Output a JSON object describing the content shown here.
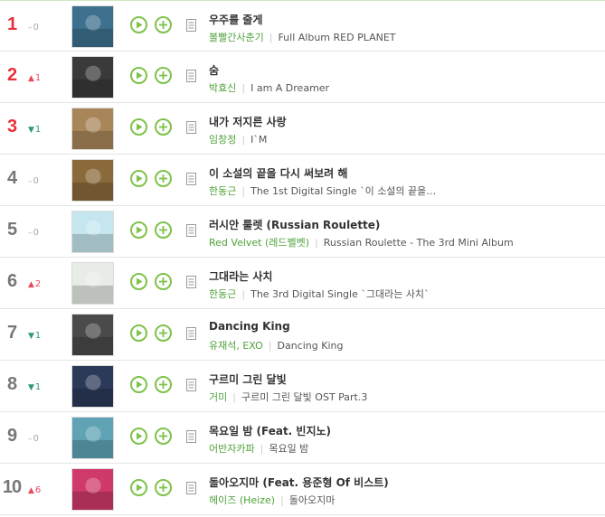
{
  "chart": {
    "rows": [
      {
        "rank": "1",
        "change_dir": "same",
        "change_value": "0",
        "title": "우주를 줄게",
        "artist": "볼빨간사춘기",
        "album": "Full Album RED PLANET",
        "art_color": "#3d6f8e"
      },
      {
        "rank": "2",
        "change_dir": "up",
        "change_value": "1",
        "title": "숨",
        "artist": "박효신",
        "album": "I am A Dreamer",
        "art_color": "#3a3a3a"
      },
      {
        "rank": "3",
        "change_dir": "down",
        "change_value": "1",
        "title": "내가 저지른 사랑",
        "artist": "임창정",
        "album": "I`M",
        "art_color": "#a9865a"
      },
      {
        "rank": "4",
        "change_dir": "same",
        "change_value": "0",
        "title": "이 소설의 끝을 다시 써보려 해",
        "artist": "한동근",
        "album": "The 1st Digital Single `이 소설의 끝을…",
        "art_color": "#8a6a3a"
      },
      {
        "rank": "5",
        "change_dir": "same",
        "change_value": "0",
        "title": "러시안 룰렛 (Russian Roulette)",
        "artist": "Red Velvet (레드벨벳)",
        "album": "Russian Roulette - The 3rd Mini Album",
        "art_color": "#c6e6ef"
      },
      {
        "rank": "6",
        "change_dir": "up",
        "change_value": "2",
        "title": "그대라는 사치",
        "artist": "한동근",
        "album": "The 3rd Digital Single `그대라는 사치`",
        "art_color": "#e7ece6"
      },
      {
        "rank": "7",
        "change_dir": "down",
        "change_value": "1",
        "title": "Dancing King",
        "artist": "유재석, EXO",
        "album": "Dancing King",
        "art_color": "#4a4a4a"
      },
      {
        "rank": "8",
        "change_dir": "down",
        "change_value": "1",
        "title": "구르미 그린 달빛",
        "artist": "거미",
        "album": "구르미 그린 달빛 OST Part.3",
        "art_color": "#2b3a58"
      },
      {
        "rank": "9",
        "change_dir": "same",
        "change_value": "0",
        "title": "목요일 밤 (Feat. 빈지노)",
        "artist": "어반자카파",
        "album": "목요일 밤",
        "art_color": "#5fa3b5"
      },
      {
        "rank": "10",
        "change_dir": "up",
        "change_value": "6",
        "title": "돌아오지마 (Feat. 용준형 Of 비스트)",
        "artist": "헤이즈 (Heize)",
        "album": "돌아오지마",
        "art_color": "#d03a6a"
      }
    ]
  },
  "icons": {
    "play": "play-icon",
    "add": "plus-icon",
    "lyrics": "document-icon",
    "up": "arrow-up-icon",
    "down": "arrow-down-icon",
    "same": "dash-icon"
  },
  "colors": {
    "rank_top": "#e8313b",
    "rank_default": "#777777",
    "artist": "#4fa23a",
    "button_green": "#7ec24a",
    "up": "#e84a5f",
    "down": "#2d9b6e"
  }
}
